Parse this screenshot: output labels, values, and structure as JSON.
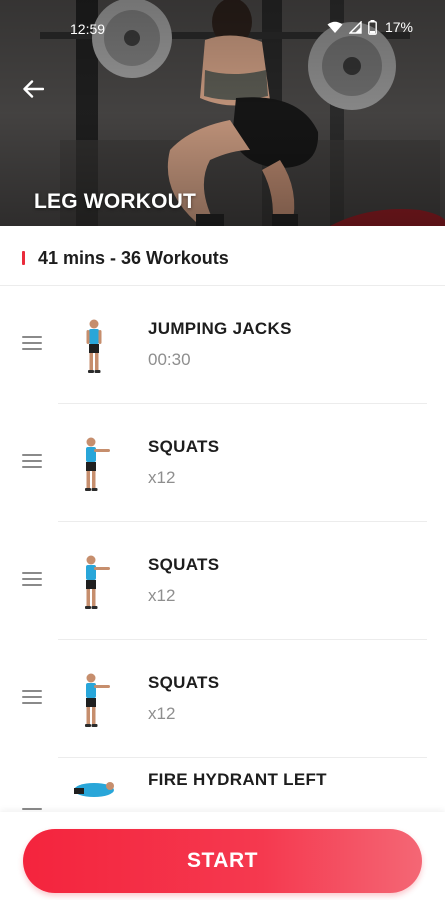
{
  "status_bar": {
    "time": "12:59",
    "battery": "17%"
  },
  "header": {
    "title": "LEG WORKOUT",
    "back_icon": "arrow-left-icon"
  },
  "summary": {
    "text": "41 mins - 36 Workouts",
    "accent_color": "#ea2b3b"
  },
  "exercises": [
    {
      "name": "JUMPING JACKS",
      "detail": "00:30"
    },
    {
      "name": "SQUATS",
      "detail": "x12"
    },
    {
      "name": "SQUATS",
      "detail": "x12"
    },
    {
      "name": "SQUATS",
      "detail": "x12"
    },
    {
      "name": "FIRE HYDRANT LEFT",
      "detail": ""
    }
  ],
  "actions": {
    "start_label": "START",
    "start_color": "#f4243d"
  }
}
